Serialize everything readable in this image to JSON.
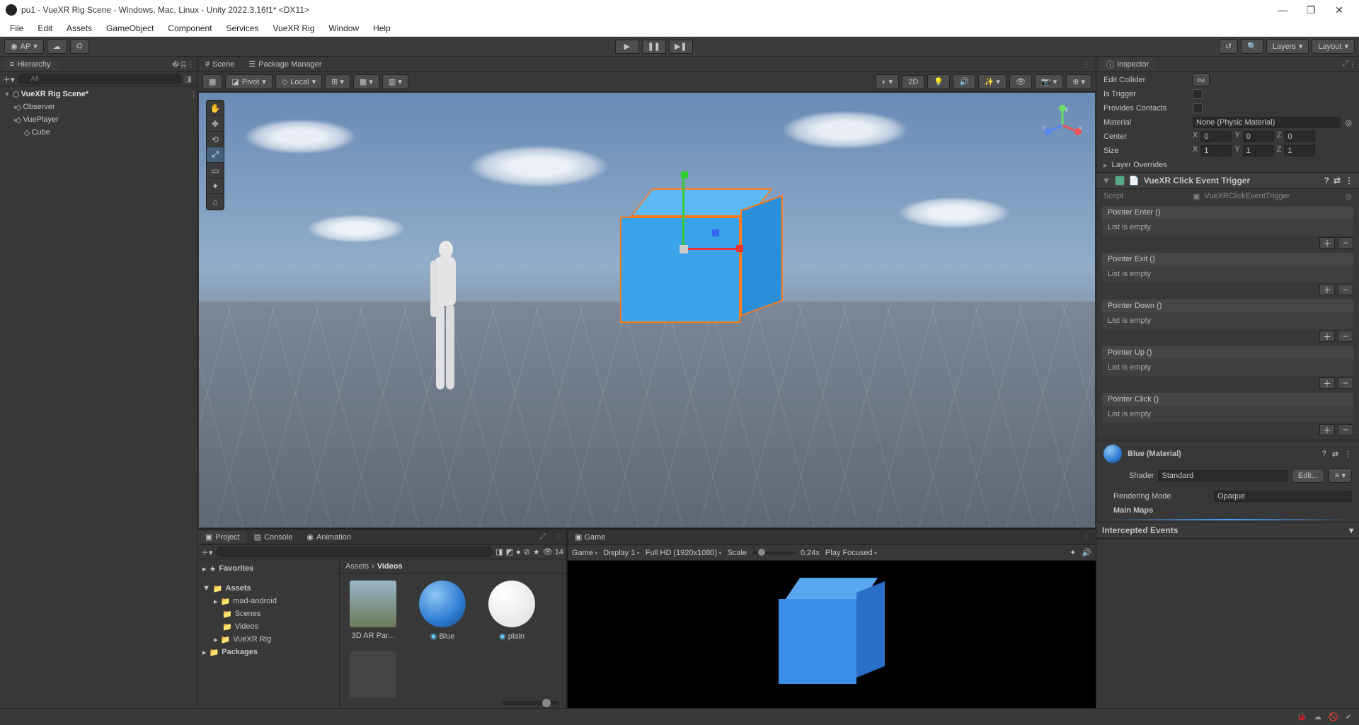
{
  "window_title": "pu1 - VueXR Rig Scene - Windows, Mac, Linux - Unity 2022.3.16f1* <DX11>",
  "menubar": [
    "File",
    "Edit",
    "Assets",
    "GameObject",
    "Component",
    "Services",
    "VueXR Rig",
    "Window",
    "Help"
  ],
  "toolbar": {
    "account": "AP",
    "layers": "Layers",
    "layout": "Layout"
  },
  "hierarchy": {
    "tab": "Hierarchy",
    "search_placeholder": "All",
    "scene": "VueXR Rig Scene*",
    "items": [
      "Observer",
      "VuePlayer",
      "Cube"
    ]
  },
  "scene": {
    "tab_scene": "Scene",
    "tab_pkg": "Package Manager",
    "pivot": "Pivot",
    "space": "Local",
    "btn_2d": "2D"
  },
  "project": {
    "tab_project": "Project",
    "tab_console": "Console",
    "tab_anim": "Animation",
    "count": "14",
    "tree": {
      "favorites": "Favorites",
      "assets": "Assets",
      "items": [
        "mad-android",
        "Scenes",
        "Videos",
        "VueXR Rig"
      ],
      "packages": "Packages"
    },
    "breadcrumb": [
      "Assets",
      "Videos"
    ],
    "thumbs": [
      {
        "name": "3D AR Par..."
      },
      {
        "name": "Blue"
      },
      {
        "name": "plain"
      }
    ]
  },
  "game": {
    "tab": "Game",
    "mode": "Game",
    "display": "Display 1",
    "res": "Full HD (1920x1080)",
    "scale_label": "Scale",
    "scale": "0.24x",
    "play": "Play Focused"
  },
  "inspector": {
    "tab": "Inspector",
    "edit_collider": "Edit Collider",
    "is_trigger": "Is Trigger",
    "provides": "Provides Contacts",
    "material": "Material",
    "material_val": "None (Physic Material)",
    "center": "Center",
    "size": "Size",
    "layer_overrides": "Layer Overrides",
    "center_vals": {
      "x": "0",
      "y": "0",
      "z": "0"
    },
    "size_vals": {
      "x": "1",
      "y": "1",
      "z": "1"
    },
    "component": "VueXR Click Event Trigger",
    "script_label": "Script",
    "script_val": "VueXRClickEventTrigger",
    "events": [
      "Pointer Enter ()",
      "Pointer Exit ()",
      "Pointer Down ()",
      "Pointer Up ()",
      "Pointer Click ()"
    ],
    "empty": "List is empty",
    "material_header": "Blue (Material)",
    "shader_label": "Shader",
    "shader_val": "Standard",
    "edit_btn": "Edit...",
    "rendering_mode": "Rendering Mode",
    "rendering_val": "Opaque",
    "main_maps": "Main Maps",
    "intercepted": "Intercepted Events"
  }
}
